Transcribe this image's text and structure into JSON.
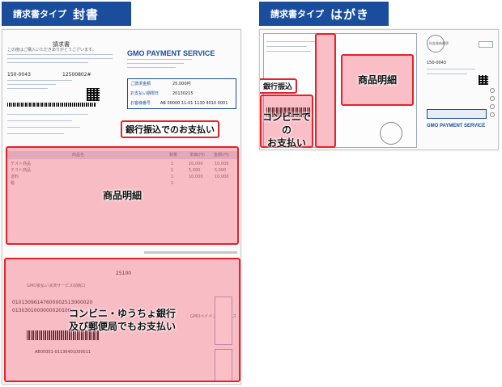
{
  "tabs": {
    "left": {
      "prefix": "請求書タイプ",
      "name": "封書"
    },
    "right": {
      "prefix": "請求書タイプ",
      "name": "はがき"
    }
  },
  "left_paper": {
    "title": "請求書",
    "intro": "この度はご購入いただきありがとうございます。",
    "postcode": "150-0043",
    "number": "12500802#",
    "brand": "GMO PAYMENT SERVICE",
    "field_rows": [
      "ご請求金額",
      "お支払い期限日",
      "お客様番号"
    ],
    "field_values": [
      "25,000円",
      "20130215",
      "AB 00000 11-01 1130 4010 0001"
    ],
    "table_columns": [
      "商品名",
      "数量",
      "単価(円)",
      "金額(円)"
    ],
    "table_rows": [
      [
        "テスト商品",
        "1",
        "10,000",
        "10,000"
      ],
      [
        "テスト商品",
        "1",
        "5,000",
        "5,000"
      ],
      [
        "送料",
        "1",
        "10,000",
        "10,000"
      ],
      [
        "税",
        "1",
        "",
        ""
      ]
    ],
    "slip_amount": "25100",
    "slip_bank": "GMO後払い決済サービス収納口",
    "slip_code": "01013096147600002513000020",
    "slip_code2": "0130301000000020100",
    "slip_digits": "AB00001-01130401000011",
    "slip_company": "GMOペイメントサービス",
    "highlights": {
      "bank": "銀行振込でのお支払い",
      "items": "商品明細",
      "convenience_line1": "コンビニ・ゆうちょ銀行",
      "convenience_line2": "及び郵便局でもお支払い"
    }
  },
  "right_paper": {
    "postcode": "150-0043",
    "brand": "GMO PAYMENT SERVICE",
    "stamp_text": "料金後納郵便",
    "highlights": {
      "bank": "銀行振込",
      "items": "商品明細",
      "convenience_line1": "コンビニでの",
      "convenience_line2": "お支払い"
    }
  }
}
